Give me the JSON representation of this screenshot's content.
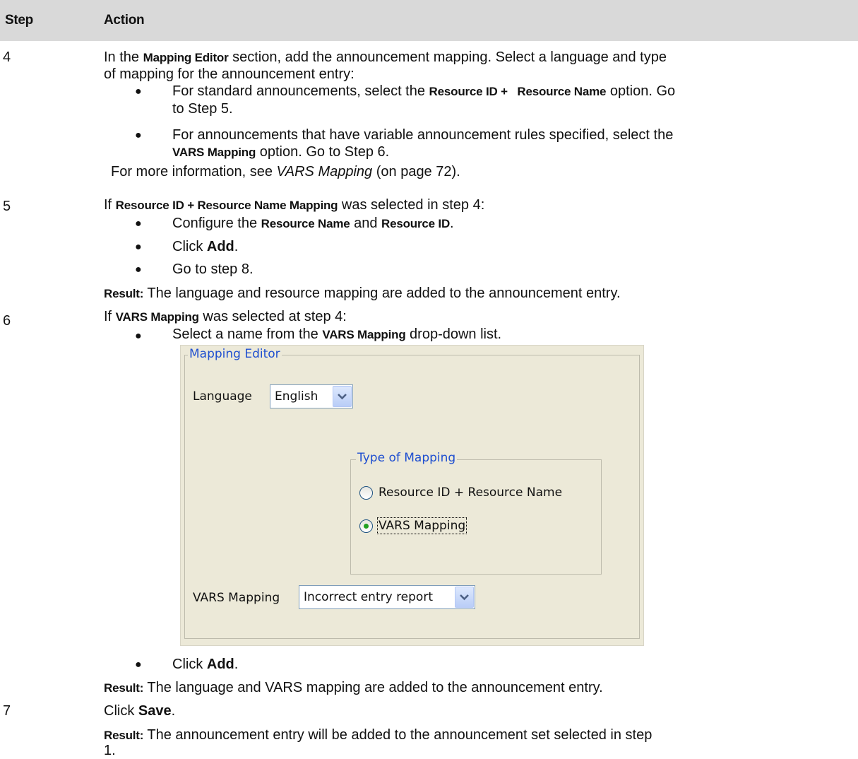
{
  "header": {
    "step": "Step",
    "action": "Action"
  },
  "step4": {
    "num": "4",
    "intro_pre": "In the ",
    "intro_bold": "Mapping Editor",
    "intro_post": " section, add the announcement mapping. Select a language and type",
    "intro_line2": "of mapping for the announcement entry:",
    "b1_pre": "For standard announcements, select the ",
    "b1_bold": "Resource ID +   Resource Name",
    "b1_post": " option. Go",
    "b1_line2": "to Step 5.",
    "b2_line1": "For announcements that have variable announcement rules specified, select the",
    "b2_bold": "VARS Mapping",
    "b2_post": " option. Go to Step 6.",
    "more_pre": "For more information, see ",
    "more_link": "VARS Mapping",
    "more_post": " (on page 72)."
  },
  "step5": {
    "num": "5",
    "line_pre": "If ",
    "line_bold": "Resource ID + Resource Name Mapping",
    "line_post": " was selected in step 4:",
    "b1_pre": "Configure the ",
    "b1_bold1": "Resource Name",
    "b1_mid": " and ",
    "b1_bold2": "Resource ID",
    "b1_post": ".",
    "b2_pre": "Click ",
    "b2_bold": "Add",
    "b2_post": ".",
    "b3": "Go to step 8.",
    "result_label": "Result:",
    "result_text": " The language and resource mapping are added to the announcement entry."
  },
  "step6": {
    "num": "6",
    "line_pre": "If ",
    "line_bold": "VARS Mapping",
    "line_post": " was selected at step 4:",
    "b1_pre": "Select a name from the ",
    "b1_bold": "VARS Mapping",
    "b1_post": " drop-down list.",
    "b2_pre": "Click ",
    "b2_bold": "Add",
    "b2_post": ".",
    "result_label": "Result:",
    "result_text": " The language and VARS mapping are added to the announcement entry."
  },
  "step7": {
    "num": "7",
    "line_pre": "Click ",
    "line_bold": "Save",
    "line_post": ".",
    "result_label": "Result:",
    "result_text": " The announcement entry will be added to the announcement set selected in step",
    "result_line2": "1."
  },
  "dialog": {
    "group_title": "Mapping Editor",
    "language_label": "Language",
    "language_value": "English",
    "type_group_title": "Type of Mapping",
    "radio1_label": "Resource ID + Resource Name",
    "radio2_label": "VARS Mapping",
    "radio2_selected": true,
    "vars_label": "VARS Mapping",
    "vars_value": "Incorrect entry report"
  }
}
